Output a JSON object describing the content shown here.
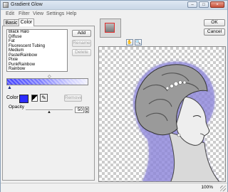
{
  "window": {
    "title": "Gradient Glow",
    "controls": [
      "–",
      "□",
      "×"
    ]
  },
  "menu": [
    "Edit",
    "Filter",
    "View",
    "Settings",
    "Help"
  ],
  "tabs": [
    {
      "label": "Basic",
      "active": false
    },
    {
      "label": "Color",
      "active": true
    }
  ],
  "presets": {
    "items": [
      "Black Halo",
      "Diffuse",
      "Fat",
      "Fluorescent Tubing",
      "Medium",
      "PastelRainbow",
      "Pixie",
      "PunkRainbow",
      "Rainbow"
    ]
  },
  "buttons": {
    "add": "Add",
    "rename": "Rename",
    "delete": "Delete",
    "remove": "Remove",
    "ok": "OK",
    "cancel": "Cancel"
  },
  "color": {
    "label": "Color",
    "value": "#2c2cff"
  },
  "opacity": {
    "label": "Opacity",
    "value": "50",
    "fraction": 0.5
  },
  "status": {
    "zoom": "100%"
  },
  "icons": {
    "app": "app-icon",
    "hand": "hand-tool-icon",
    "zoom": "zoom-tool-icon",
    "eyedropper": "eyedropper-icon"
  }
}
